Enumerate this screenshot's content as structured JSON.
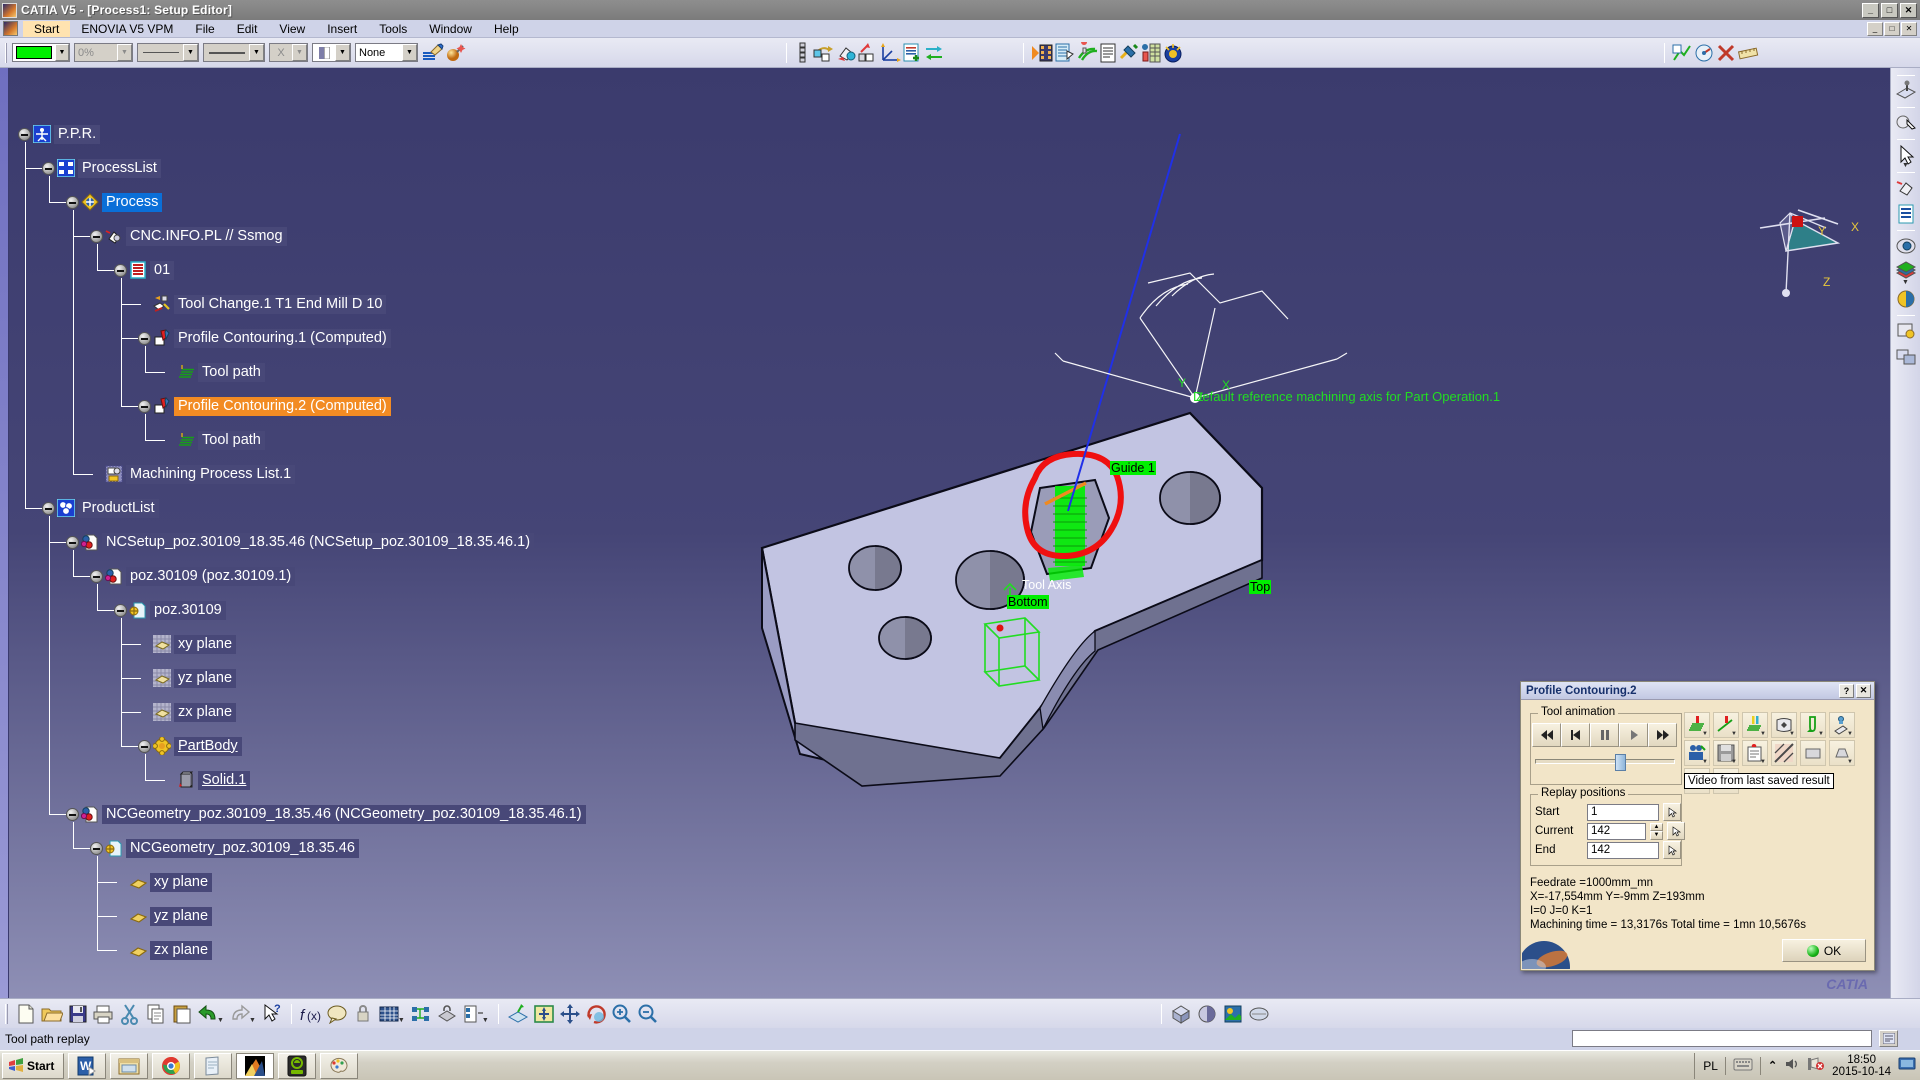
{
  "window": {
    "title": "CATIA V5 - [Process1: Setup Editor]",
    "min_label": "_",
    "max_label": "□",
    "close_label": "✕",
    "doc_min": "_",
    "doc_max": "□",
    "doc_close": "✕"
  },
  "menu": {
    "items": [
      "Start",
      "ENOVIA V5 VPM",
      "File",
      "Edit",
      "View",
      "Insert",
      "Tools",
      "Window",
      "Help"
    ],
    "active": "Start"
  },
  "graphic_toolbar": {
    "color_value": "",
    "color_hex": "#00f000",
    "transparency_value": "0%",
    "linetype_value": "",
    "lineweight_value": "",
    "point_value": "X",
    "layer_value": "",
    "render_value": "None",
    "painter_icon": "painter-brush-icon",
    "wizard_icon": "magic-wand-icon"
  },
  "tree": {
    "nodes": [
      {
        "label": "P.P.R.",
        "icon": "ppr-icon",
        "depth": 0,
        "state": "plain"
      },
      {
        "label": "ProcessList",
        "icon": "processlist-icon",
        "depth": 1,
        "state": "plain"
      },
      {
        "label": "Process",
        "icon": "process-gear-icon",
        "depth": 2,
        "state": "selected"
      },
      {
        "label": "CNC.INFO.PL  // Ssmog",
        "icon": "part-operation-icon",
        "depth": 3,
        "state": "plain"
      },
      {
        "label": "01",
        "icon": "manufacturing-program-icon",
        "depth": 4,
        "state": "plain"
      },
      {
        "label": "Tool Change.1  T1 End Mill D 10",
        "icon": "tool-change-icon",
        "depth": 5,
        "state": "plain"
      },
      {
        "label": "Profile Contouring.1 (Computed)",
        "icon": "profile-contouring-icon",
        "depth": 5,
        "state": "plain"
      },
      {
        "label": "Tool path",
        "icon": "tool-path-icon",
        "depth": 6,
        "state": "plain"
      },
      {
        "label": "Profile Contouring.2 (Computed)",
        "icon": "profile-contouring-icon",
        "depth": 5,
        "state": "highlighted"
      },
      {
        "label": "Tool path",
        "icon": "tool-path-icon",
        "depth": 6,
        "state": "plain"
      },
      {
        "label": "Machining Process List.1",
        "icon": "machining-process-list-icon",
        "depth": 3,
        "state": "plain"
      },
      {
        "label": "ProductList",
        "icon": "productlist-icon",
        "depth": 1,
        "state": "plain"
      },
      {
        "label": "NCSetup_poz.30109_18.35.46 (NCSetup_poz.30109_18.35.46.1)",
        "icon": "product-icon",
        "depth": 2,
        "state": "plain"
      },
      {
        "label": "poz.30109 (poz.30109.1)",
        "icon": "product-icon",
        "depth": 3,
        "state": "plain"
      },
      {
        "label": "poz.30109",
        "icon": "part-icon",
        "depth": 4,
        "state": "plain"
      },
      {
        "label": "xy plane",
        "icon": "plane-hatched-icon",
        "depth": 5,
        "state": "plain"
      },
      {
        "label": "yz plane",
        "icon": "plane-hatched-icon",
        "depth": 5,
        "state": "plain"
      },
      {
        "label": "zx plane",
        "icon": "plane-hatched-icon",
        "depth": 5,
        "state": "plain"
      },
      {
        "label": "PartBody",
        "icon": "partbody-icon",
        "depth": 5,
        "state": "underlined"
      },
      {
        "label": "Solid.1",
        "icon": "solid-icon",
        "depth": 6,
        "state": "underlined"
      },
      {
        "label": "NCGeometry_poz.30109_18.35.46 (NCGeometry_poz.30109_18.35.46.1)",
        "icon": "product-icon",
        "depth": 2,
        "state": "plain"
      },
      {
        "label": "NCGeometry_poz.30109_18.35.46",
        "icon": "part-icon",
        "depth": 3,
        "state": "plain"
      },
      {
        "label": "xy plane",
        "icon": "plane-yellow-icon",
        "depth": 4,
        "state": "plain"
      },
      {
        "label": "yz plane",
        "icon": "plane-yellow-icon",
        "depth": 4,
        "state": "plain"
      },
      {
        "label": "zx plane",
        "icon": "plane-yellow-icon",
        "depth": 4,
        "state": "plain"
      }
    ]
  },
  "viewport": {
    "axis_note": "Default reference machining axis for Part Operation.1",
    "axis_x": "X",
    "axis_y": "Y",
    "axis_z": "Z",
    "labels": [
      {
        "name": "guide-1-label",
        "text": "Guide 1"
      },
      {
        "name": "tool-axis-label",
        "text": "Tool Axis"
      },
      {
        "name": "bottom-label",
        "text": "Bottom"
      },
      {
        "name": "top-label",
        "text": "Top"
      }
    ],
    "compass": {
      "x": "X",
      "y": "Y",
      "z": "Z"
    }
  },
  "dialog": {
    "title": "Profile Contouring.2",
    "help_label": "?",
    "close_label": "✕",
    "tool_animation": {
      "legend": "Tool animation",
      "buttons": [
        "rewind-to-start",
        "step-back",
        "pause",
        "play",
        "fast-forward"
      ]
    },
    "replay": {
      "legend": "Replay positions",
      "start_label": "Start",
      "start_value": "1",
      "current_label": "Current",
      "current_value": "142",
      "end_label": "End",
      "end_value": "142"
    },
    "tooltip": "Video from last saved result",
    "info": [
      "Feedrate =1000mm_mn",
      "X=-17,554mm Y=-9mm Z=193mm",
      "I=0 J=0 K=1",
      "Machining time = 13,3176s   Total time = 1mn 10,5676s"
    ],
    "ok_label": "OK"
  },
  "statusbar": {
    "message": "Tool path replay",
    "input_value": ""
  },
  "taskbar": {
    "start_label": "Start",
    "apps": [
      {
        "name": "word-taskbar-button",
        "active": false
      },
      {
        "name": "explorer-taskbar-button",
        "active": false
      },
      {
        "name": "chrome-taskbar-button",
        "active": false
      },
      {
        "name": "notepad-taskbar-button",
        "active": false
      },
      {
        "name": "catia-taskbar-button",
        "active": true
      },
      {
        "name": "nvidia-taskbar-button",
        "active": false
      },
      {
        "name": "paint-taskbar-button",
        "active": false
      }
    ],
    "tray": {
      "language": "PL",
      "time": "18:50",
      "date": "2015-10-14"
    }
  }
}
